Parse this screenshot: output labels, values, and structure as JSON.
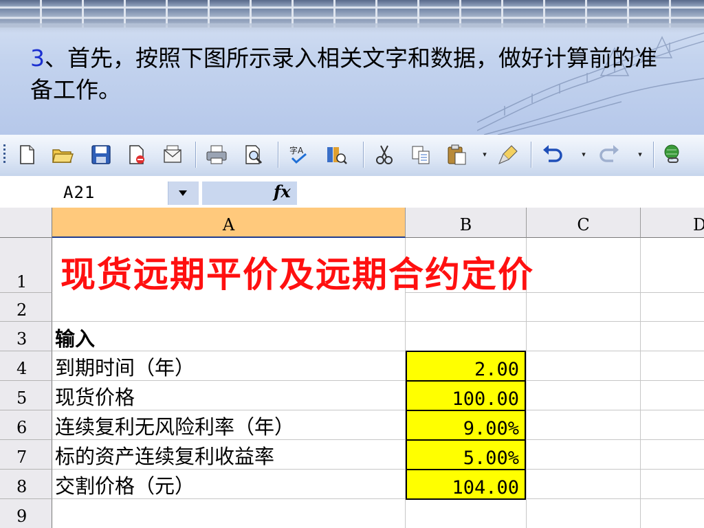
{
  "slide": {
    "step_number": "3",
    "instruction_rest": "、首先，按照下图所示录入相关文字和数据，做好计算前的准备工作。"
  },
  "toolbar": {
    "buttons": [
      {
        "name": "new-document-icon"
      },
      {
        "name": "open-folder-icon"
      },
      {
        "name": "save-icon"
      },
      {
        "name": "permission-icon"
      },
      {
        "name": "email-icon"
      },
      {
        "name": "print-icon"
      },
      {
        "name": "print-preview-icon"
      },
      {
        "name": "spelling-icon"
      },
      {
        "name": "research-icon"
      },
      {
        "name": "cut-icon"
      },
      {
        "name": "copy-icon"
      },
      {
        "name": "paste-icon"
      },
      {
        "name": "format-painter-icon"
      },
      {
        "name": "undo-icon"
      },
      {
        "name": "redo-icon"
      },
      {
        "name": "hyperlink-icon"
      }
    ],
    "dropdown_glyph": "▾"
  },
  "formula_bar": {
    "name_box": "A21",
    "fx_label": "fx",
    "formula": ""
  },
  "sheet": {
    "columns": [
      "A",
      "B",
      "C",
      "D"
    ],
    "selected_column": "A",
    "rows": [
      "1",
      "2",
      "3",
      "4",
      "5",
      "6",
      "7",
      "8",
      "9"
    ],
    "title": "现货远期平价及远期合约定价",
    "section_label": "输入",
    "labels": [
      "到期时间（年）",
      "现货价格",
      "连续复利无风险利率（年）",
      "标的资产连续复利收益率",
      "交割价格（元）"
    ],
    "values": [
      "2.00",
      "100.00",
      "9.00%",
      "5.00%",
      "104.00"
    ],
    "colors": {
      "title_red": "#ff1010",
      "input_fill": "#ffff00",
      "selected_header": "#ffc97c"
    }
  }
}
